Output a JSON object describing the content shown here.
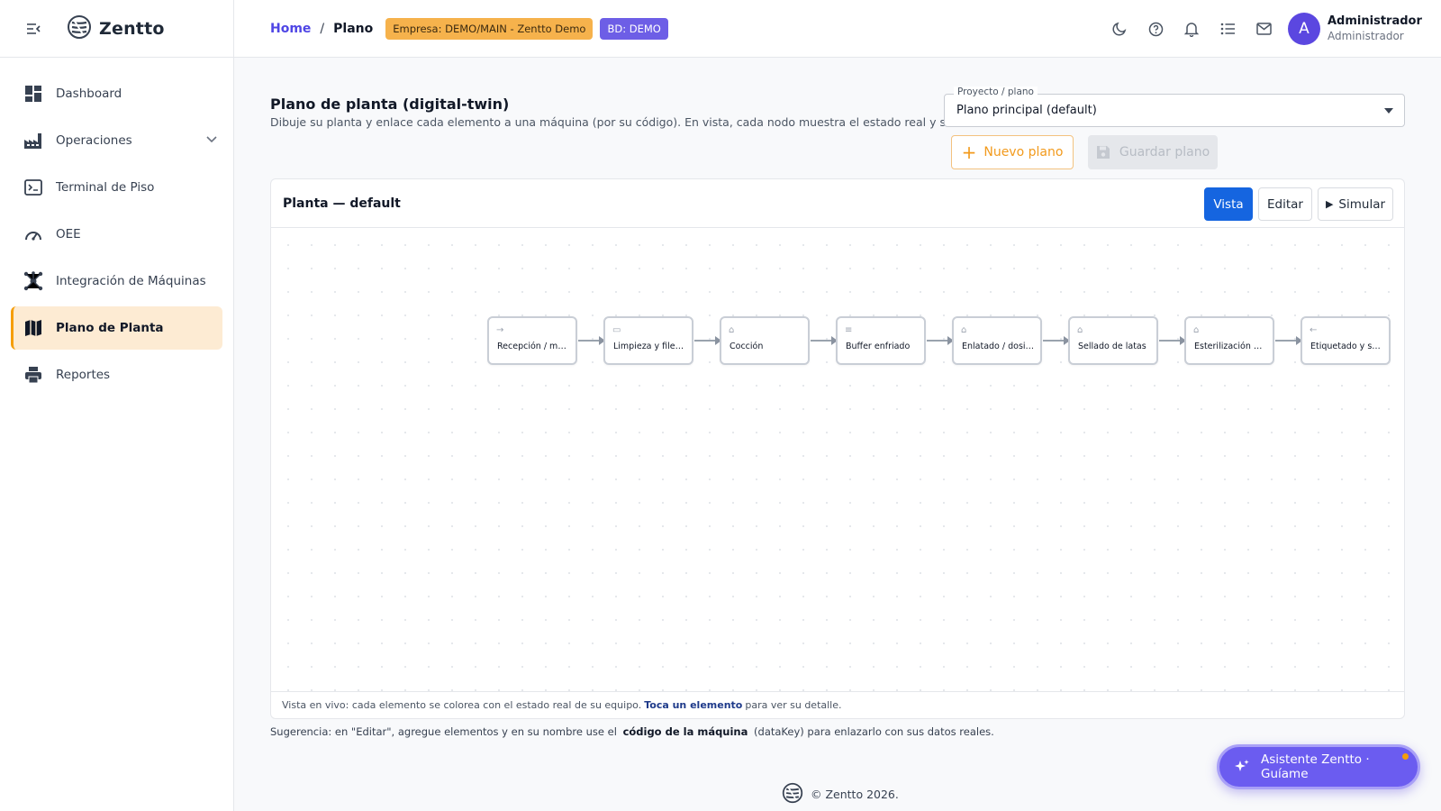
{
  "app": {
    "name": "Zentto"
  },
  "sidebar": {
    "items": [
      {
        "label": "Dashboard",
        "icon": "dashboard-icon"
      },
      {
        "label": "Operaciones",
        "icon": "factory-icon"
      },
      {
        "label": "Terminal de Piso",
        "icon": "terminal-icon"
      },
      {
        "label": "OEE",
        "icon": "gauge-icon"
      },
      {
        "label": "Integración de Máquinas",
        "icon": "hub-icon"
      },
      {
        "label": "Plano de Planta",
        "icon": "map-icon"
      },
      {
        "label": "Reportes",
        "icon": "printer-icon"
      }
    ],
    "active": "Plano de Planta"
  },
  "header": {
    "breadcrumb": {
      "home": "Home",
      "separator": "/",
      "current": "Plano"
    },
    "badges": {
      "company": "Empresa: DEMO/MAIN - Zentto Demo",
      "db": "BD: DEMO"
    },
    "user": {
      "initial": "A",
      "name": "Administrador",
      "role": "Administrador"
    }
  },
  "page": {
    "title": "Plano de planta (digital-twin)",
    "subtitle": "Dibuje su planta y enlace cada elemento a una máquina (por su código). En vista, cada nodo muestra el estado real y su OEE.",
    "project_select": {
      "label": "Proyecto / plano",
      "value": "Plano principal (default)"
    },
    "buttons": {
      "new_plan": "Nuevo plano",
      "save_plan": "Guardar plano"
    },
    "hint": {
      "prefix": "Sugerencia: en \"Editar\", agregue elementos y en su nombre use el",
      "bold": "código de la máquina",
      "suffix": "(dataKey) para enlazarlo con sus datos reales."
    }
  },
  "plant": {
    "title": "Planta — default",
    "modes": {
      "view": "Vista",
      "edit": "Editar",
      "simulate": "Simular"
    },
    "active_mode": "Vista",
    "nodes": [
      {
        "label": "Recepción / mat…",
        "icon": "arrow-in-icon"
      },
      {
        "label": "Limpieza y file…",
        "icon": "conveyor-icon"
      },
      {
        "label": "Cocción",
        "icon": "machine-icon"
      },
      {
        "label": "Buffer enfriado",
        "icon": "buffer-icon"
      },
      {
        "label": "Enlatado / dosi…",
        "icon": "machine-icon"
      },
      {
        "label": "Sellado de latas",
        "icon": "machine-icon"
      },
      {
        "label": "Esterilización …",
        "icon": "machine-icon"
      },
      {
        "label": "Etiquetado y sa…",
        "icon": "arrow-out-icon"
      }
    ],
    "footer": {
      "prefix": "Vista en vivo: cada elemento se colorea con el estado real de su equipo.",
      "bold": "Toca un elemento",
      "suffix": "para ver su detalle."
    }
  },
  "footer": {
    "copyright": "© Zentto 2026."
  },
  "assistant": {
    "label": "Asistente Zentto · Guíame"
  },
  "colors": {
    "accent": "#f59e0b",
    "primary": "#1565e0",
    "brand_purple": "#6b5cf0"
  }
}
